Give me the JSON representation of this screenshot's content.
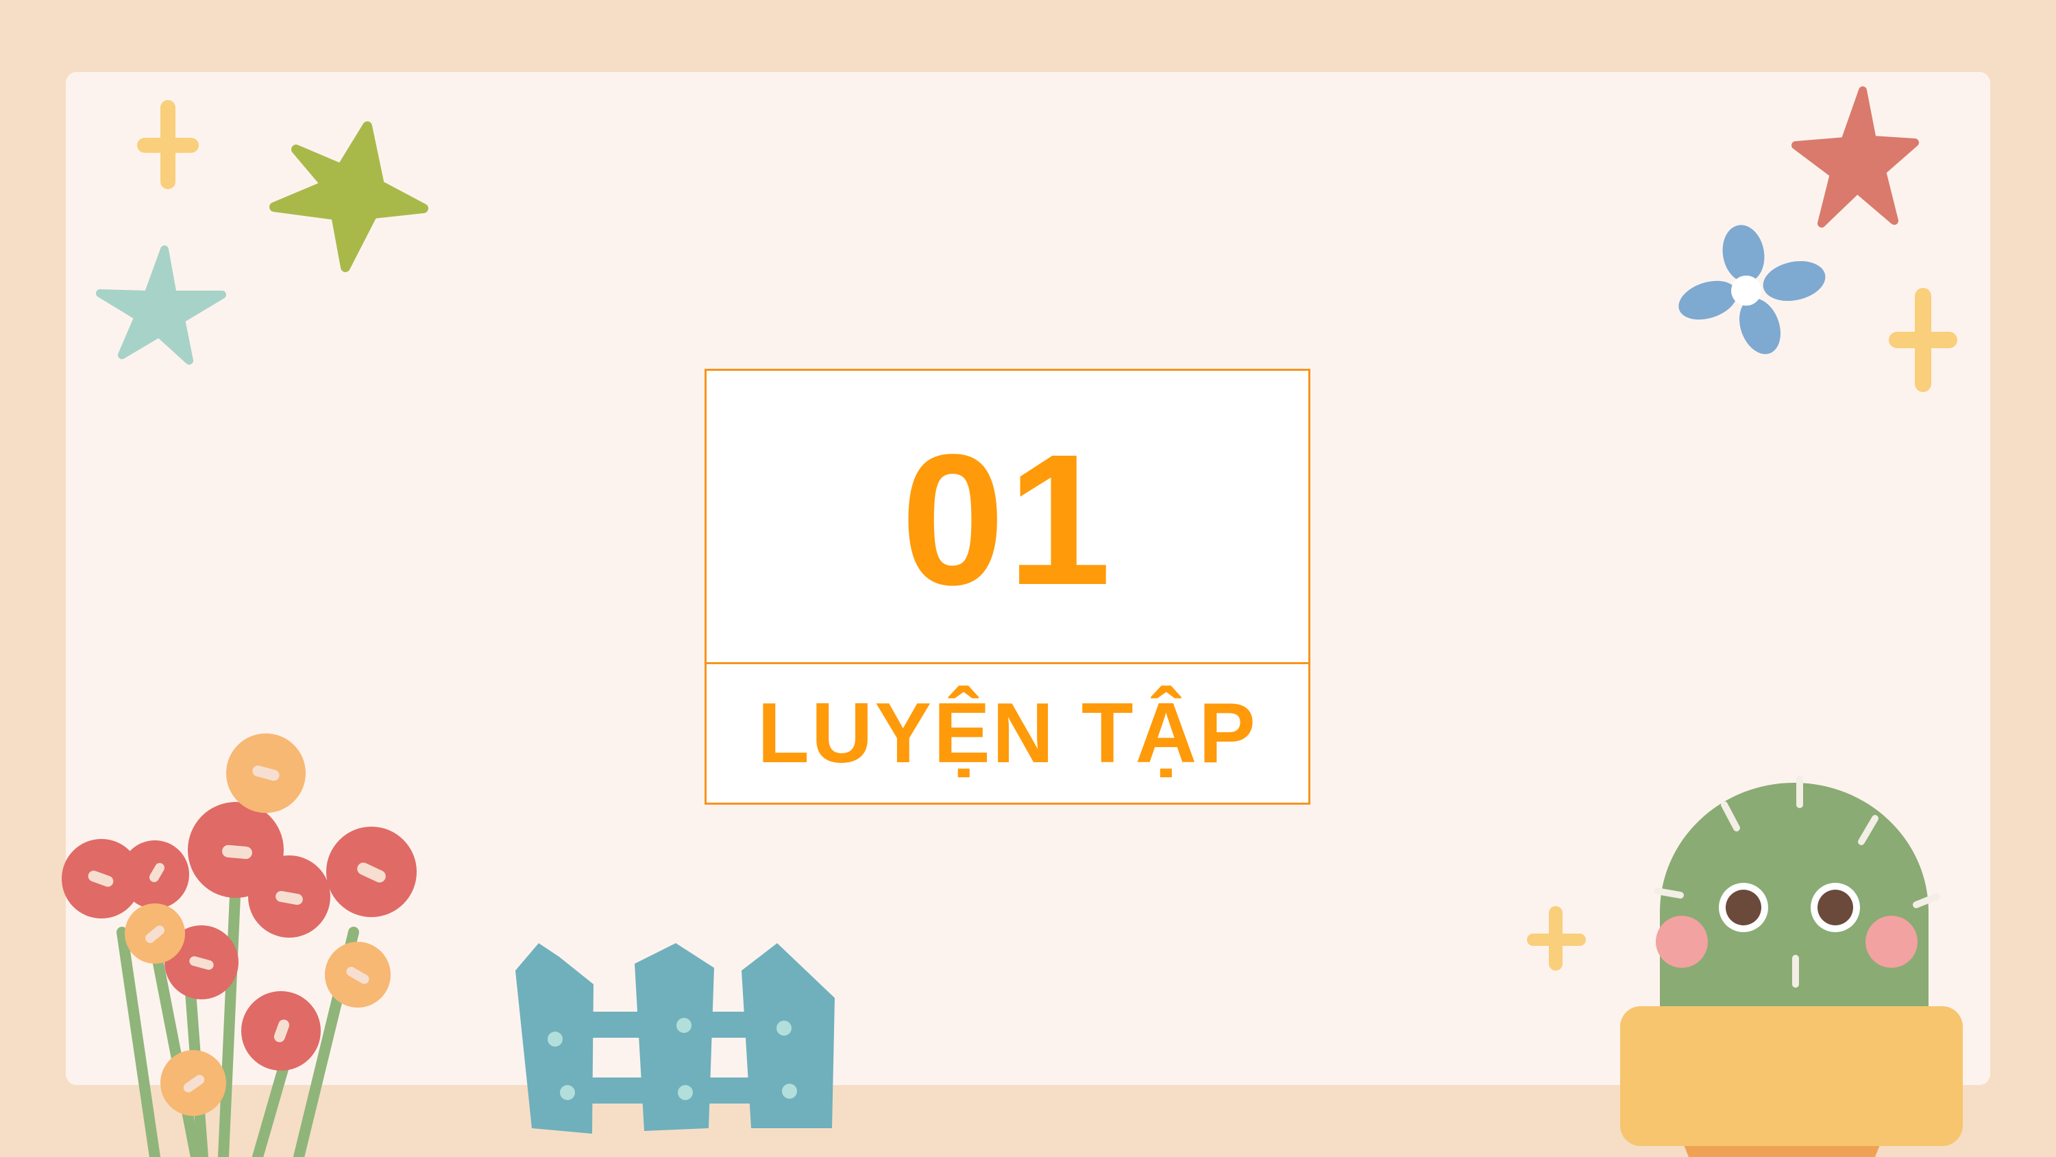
{
  "slide": {
    "number": "01",
    "title": "LUYỆN TẬP"
  },
  "colors": {
    "background": "#f6dec6",
    "card": "#fdf3ee",
    "accent_orange": "#ff9a0a",
    "border_orange": "#f7941d",
    "star_green": "#a8b94a",
    "star_teal": "#a7d2c8",
    "star_red": "#d97a6c",
    "flower_blue": "#7ea9d1",
    "plus_yellow": "#f9cf7c",
    "flower_red": "#e06a66",
    "flower_peach": "#f7b873",
    "fence_blue": "#6fb0bc",
    "cactus_green": "#8aab74",
    "pot_yellow": "#f7c56e"
  },
  "decorations": [
    "plus-icon",
    "star-icon",
    "flower-icon",
    "flower-bouquet",
    "fence",
    "cactus"
  ]
}
